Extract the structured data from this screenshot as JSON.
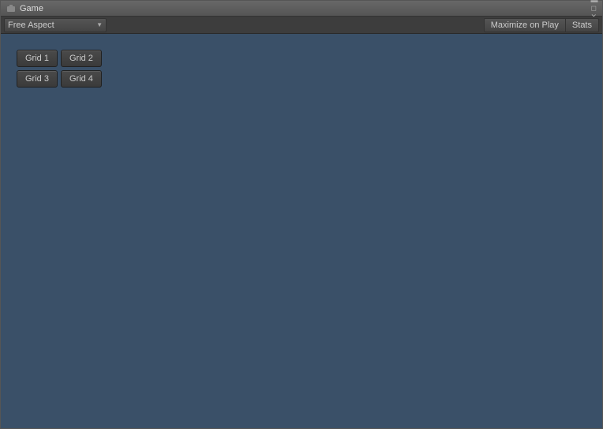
{
  "window": {
    "title": "Game",
    "icon": "game-icon"
  },
  "toolbar": {
    "aspect_label": "Free Aspect",
    "maximize_label": "Maximize on Play",
    "stats_label": "Stats"
  },
  "grid_buttons": [
    {
      "label": "Grid 1",
      "id": "grid-1"
    },
    {
      "label": "Grid 2",
      "id": "grid-2"
    },
    {
      "label": "Grid 3",
      "id": "grid-3"
    },
    {
      "label": "Grid 4",
      "id": "grid-4"
    }
  ],
  "colors": {
    "game_bg": "#3a5068",
    "toolbar_bg": "#3d3d3d",
    "title_bar_bg": "#5a5a5a"
  }
}
